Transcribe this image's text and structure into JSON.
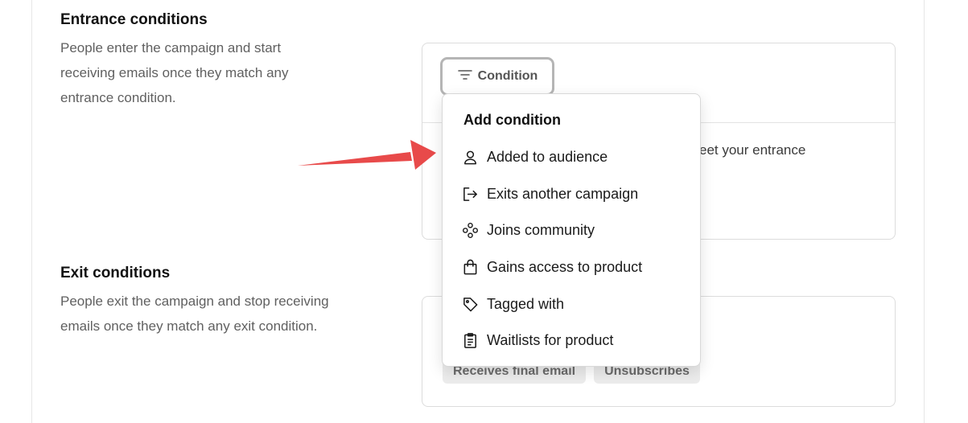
{
  "entrance": {
    "title": "Entrance conditions",
    "description": "People enter the campaign and start receiving emails once they match any entrance condition.",
    "condition_button_label": "Condition",
    "hint_text": "eet your entrance"
  },
  "exit": {
    "title": "Exit conditions",
    "description": "People exit the campaign and stop receiving emails once they match any exit condition.",
    "chips": [
      "Receives final email",
      "Unsubscribes"
    ]
  },
  "dropdown": {
    "title": "Add condition",
    "items": [
      {
        "label": "Added to audience",
        "icon": "user-icon"
      },
      {
        "label": "Exits another campaign",
        "icon": "exit-arrow-icon"
      },
      {
        "label": "Joins community",
        "icon": "community-icon"
      },
      {
        "label": "Gains access to product",
        "icon": "shopping-bag-icon"
      },
      {
        "label": "Tagged with",
        "icon": "tag-icon"
      },
      {
        "label": "Waitlists for product",
        "icon": "clipboard-list-icon"
      }
    ]
  },
  "colors": {
    "annotation_arrow": "#e84a4a",
    "chip_background": "#ececec",
    "muted_text": "#606060"
  }
}
